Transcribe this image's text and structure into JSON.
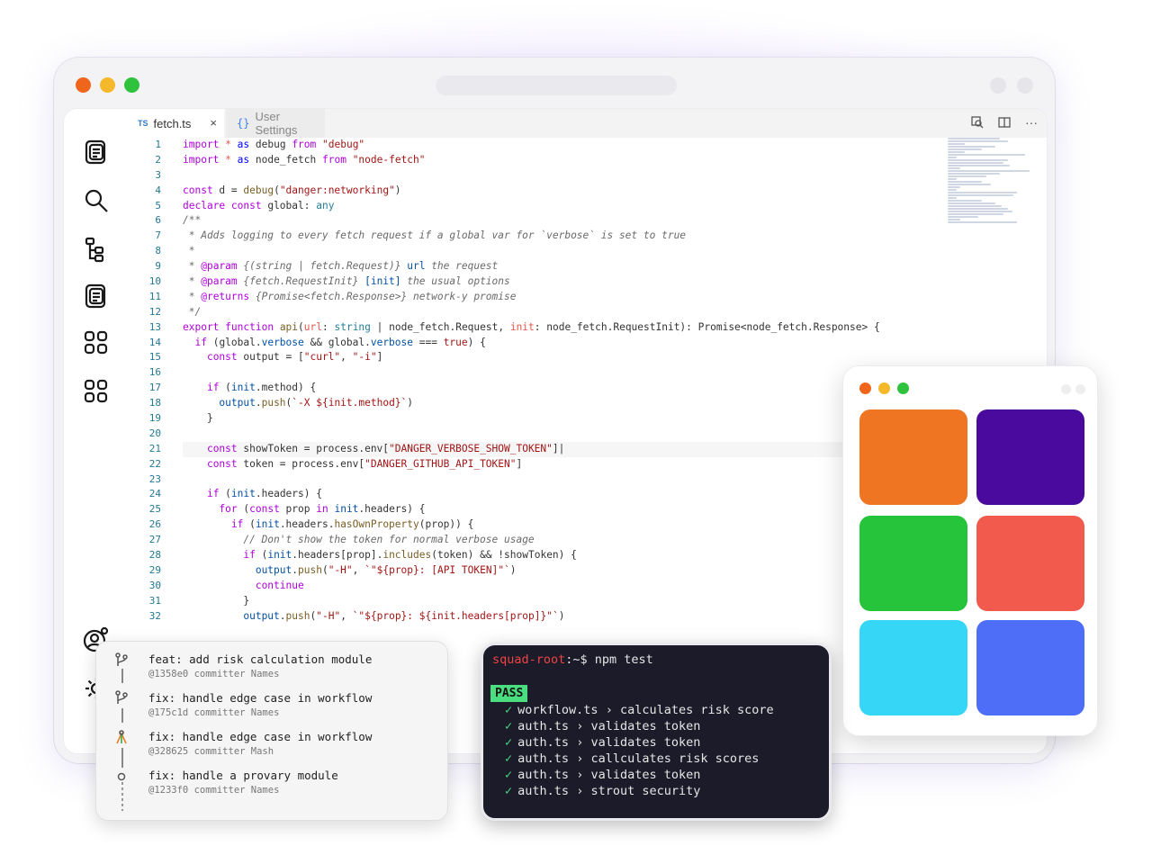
{
  "colors": {
    "traffic_red": "#f0651c",
    "traffic_yellow": "#f5b82a",
    "traffic_green": "#2fc23c",
    "pal_red": "#f0651c",
    "pal_yellow": "#f5b82a",
    "pal_green": "#2fc23c"
  },
  "editor": {
    "tabs": [
      {
        "label": "fetch.ts",
        "badge": "TS",
        "close": "×"
      },
      {
        "label": "User Settings",
        "badge": "{}"
      }
    ],
    "actions": {
      "split_icon": "split-editor-icon",
      "more_label": "···"
    },
    "line_numbers": [
      "1",
      "2",
      "3",
      "4",
      "5",
      "6",
      "7",
      "8",
      "9",
      "10",
      "11",
      "12",
      "13",
      "14",
      "15",
      "16",
      "17",
      "18",
      "19",
      "20",
      "21",
      "22",
      "23",
      "24",
      "25",
      "26",
      "27",
      "28",
      "29",
      "30",
      "31",
      "32"
    ]
  },
  "activity_icons": [
    "explorer-icon",
    "search-icon",
    "source-control-icon",
    "document-icon",
    "extensions-icon",
    "extensions-icon",
    "account-icon",
    "settings-icon"
  ],
  "git": {
    "commits": [
      {
        "message": "feat: add risk calculation module",
        "meta": "@1358e0 committer Names"
      },
      {
        "message": "fix: handle edge case in workflow",
        "meta": "@175c1d committer Names"
      },
      {
        "message": "fix: handle edge case in workflow",
        "meta": "@328625 committer Mash"
      },
      {
        "message": "fix: handle a provary module",
        "meta": "@1233f0 committer Names"
      }
    ]
  },
  "terminal": {
    "user": "squad-root",
    "prompt_rest": ":~$ npm test",
    "badge": "PASS",
    "results": [
      {
        "file": "workflow.ts",
        "sep": "›",
        "test": "calculates risk score"
      },
      {
        "file": "auth.ts",
        "sep": "›",
        "test": "validates token"
      },
      {
        "file": "auth.ts",
        "sep": "›",
        "test": "validates token"
      },
      {
        "file": "auth.ts",
        "sep": "›",
        "test": "callculates risk scores"
      },
      {
        "file": "auth.ts",
        "sep": "›",
        "test": "validates token"
      },
      {
        "file": "auth.ts",
        "sep": "›",
        "test": "strout security"
      }
    ]
  },
  "palette": {
    "swatches": [
      "#f07522",
      "#4b0a9e",
      "#26c43a",
      "#f25a4e",
      "#36d6f7",
      "#4f6ef7"
    ]
  }
}
